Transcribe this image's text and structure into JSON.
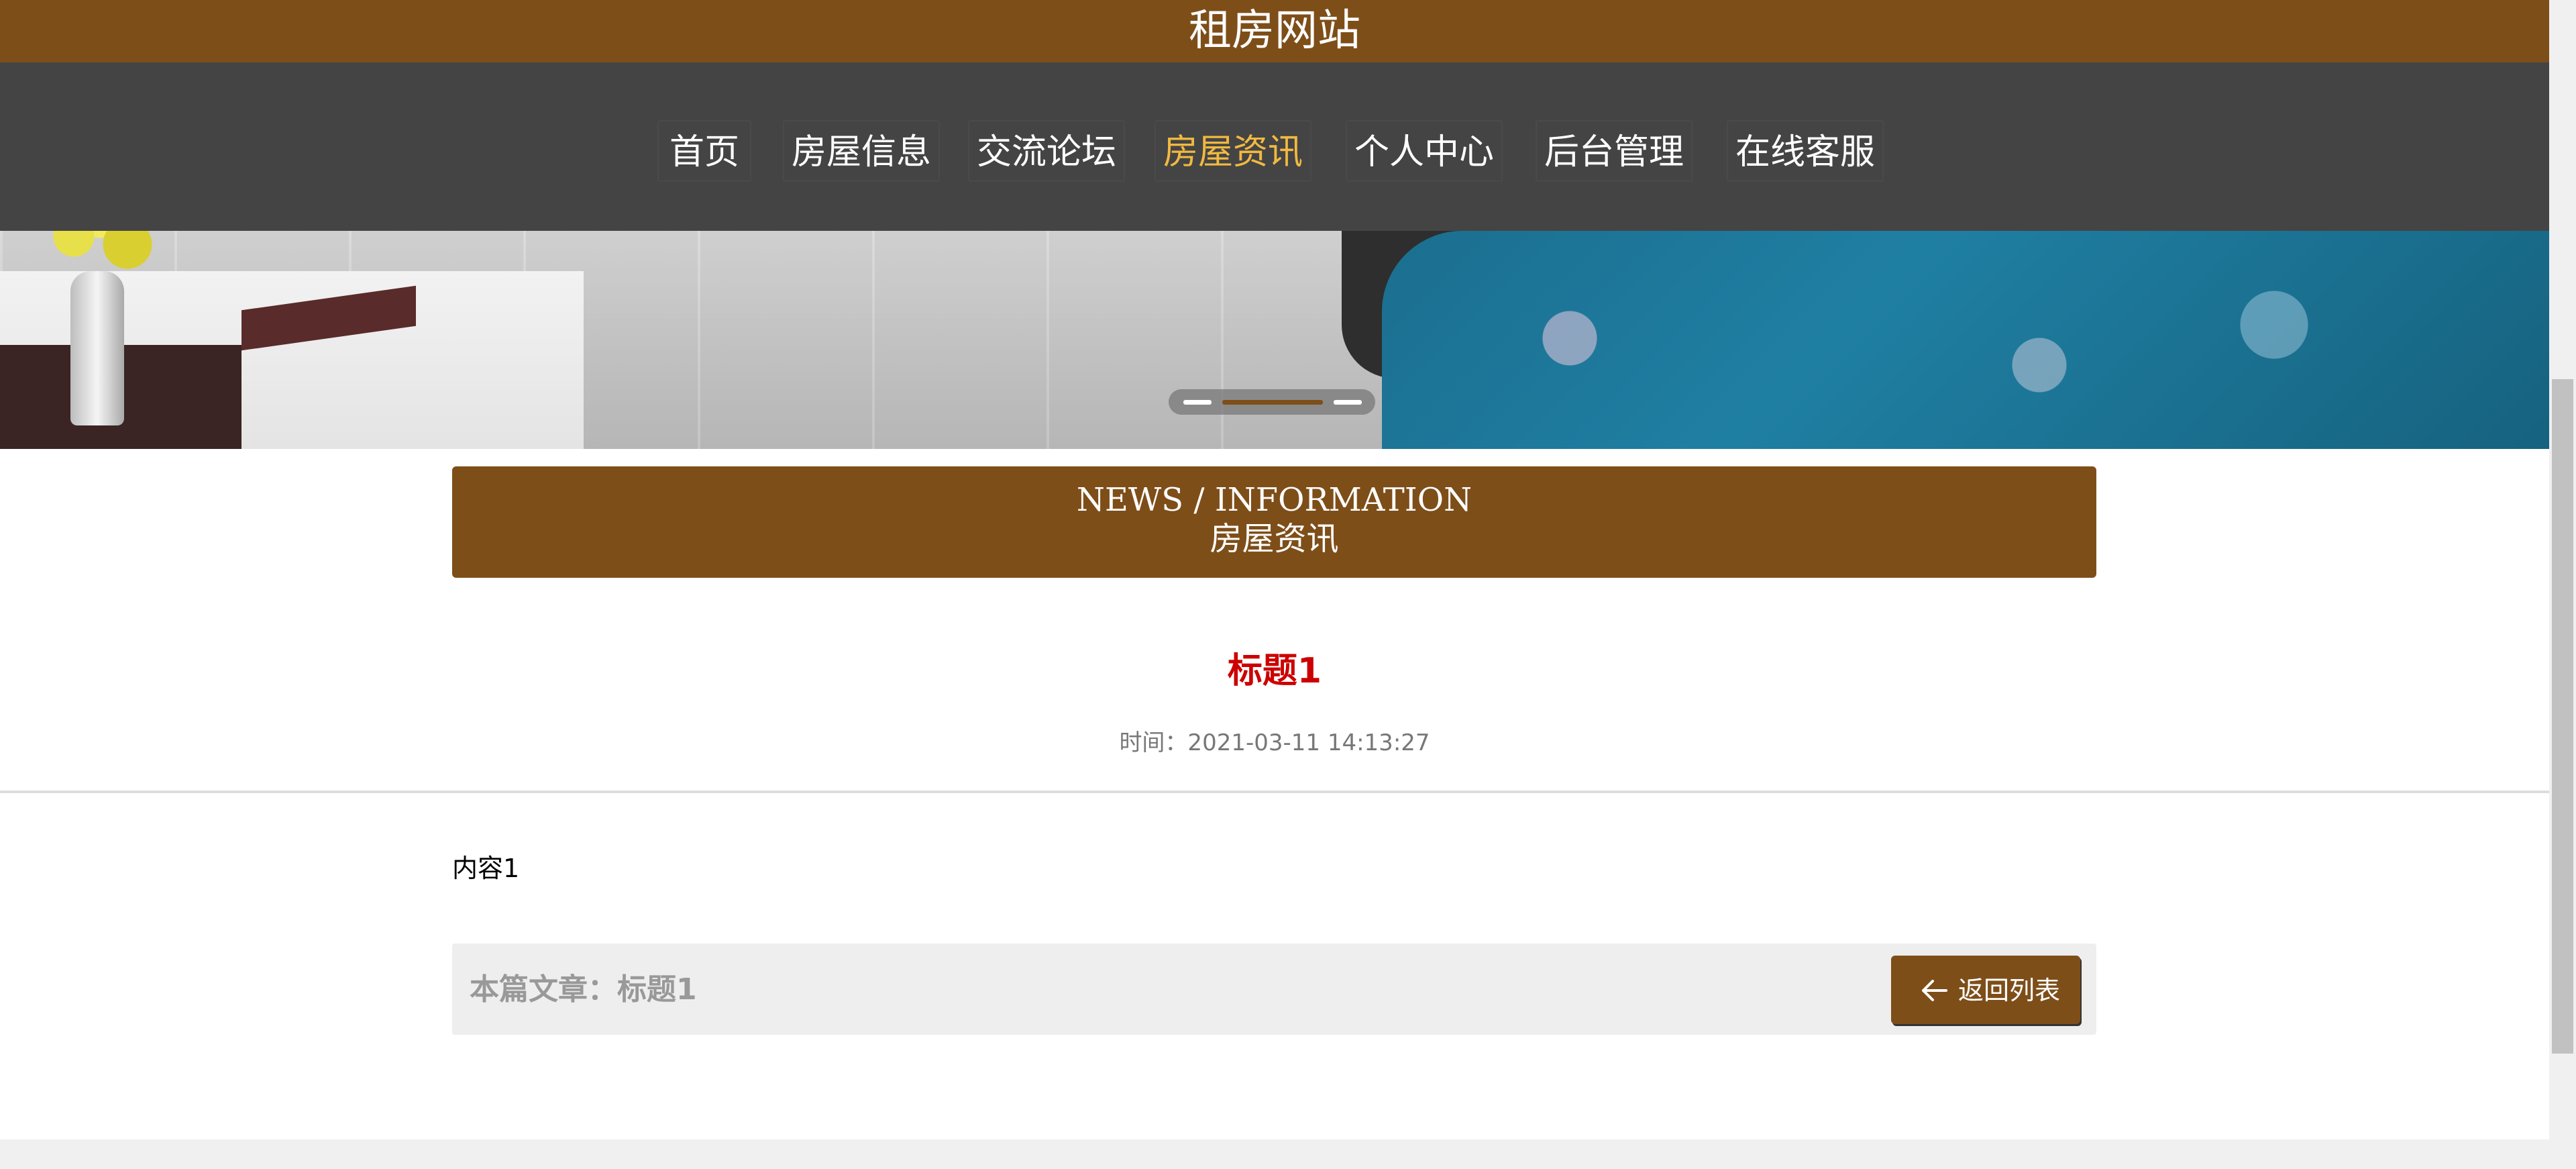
{
  "site": {
    "title": "租房网站"
  },
  "nav": {
    "items": [
      {
        "label": "首页"
      },
      {
        "label": "房屋信息"
      },
      {
        "label": "交流论坛"
      },
      {
        "label": "房屋资讯",
        "active": true
      },
      {
        "label": "个人中心"
      },
      {
        "label": "后台管理"
      },
      {
        "label": "在线客服"
      }
    ]
  },
  "section": {
    "title_en": "NEWS / INFORMATION",
    "title_cn": "房屋资讯"
  },
  "article": {
    "title": "标题1",
    "time_text": "时间：2021-03-11 14:13:27",
    "content": "内容1"
  },
  "footer": {
    "current_article": "本篇文章：标题1",
    "back_label": "返回列表"
  },
  "colors": {
    "brand": "#7e4e19",
    "nav_bg": "#444444",
    "nav_active": "#f1b940",
    "title_red": "#cc0000"
  }
}
